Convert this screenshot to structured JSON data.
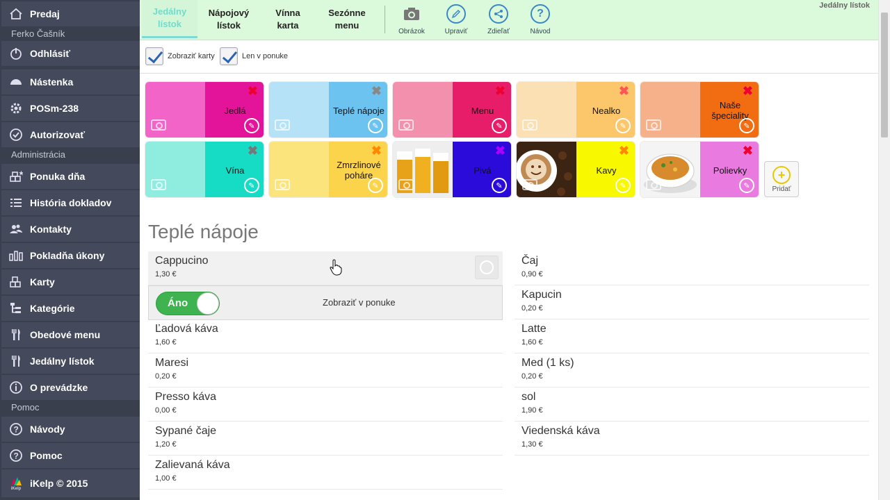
{
  "sidebar": {
    "items": [
      {
        "label": "Predaj",
        "icon": "home-icon"
      },
      {
        "label": "Odhlásiť",
        "icon": "power-icon"
      },
      {
        "label": "Nástenka",
        "icon": "dashboard-icon"
      },
      {
        "label": "POSm-238",
        "icon": "gear-icon"
      },
      {
        "label": "Autorizovať",
        "icon": "check-circle-icon"
      },
      {
        "label": "Ponuka dňa",
        "icon": "star-boxes-icon"
      },
      {
        "label": "História dokladov",
        "icon": "list-icon"
      },
      {
        "label": "Kontakty",
        "icon": "users-icon"
      },
      {
        "label": "Pokladňa úkony",
        "icon": "bars-icon"
      },
      {
        "label": "Karty",
        "icon": "boxes-icon"
      },
      {
        "label": "Kategórie",
        "icon": "tree-icon"
      },
      {
        "label": "Obedové menu",
        "icon": "cutlery-icon"
      },
      {
        "label": "Jedálny lístok",
        "icon": "cutlery-icon"
      },
      {
        "label": "O prevádzke",
        "icon": "info-icon"
      },
      {
        "label": "Návody",
        "icon": "question-icon"
      },
      {
        "label": "Pomoc",
        "icon": "question-icon"
      },
      {
        "label": "iKelp © 2015",
        "icon": "ikelp-logo"
      }
    ],
    "headers": {
      "user": "Ferko Čašník",
      "admin": "Administrácia",
      "help": "Pomoc"
    },
    "logo_small": "iKelp"
  },
  "topbar": {
    "tabs": [
      {
        "label": "Jedálny\nlístok",
        "active": true
      },
      {
        "label": "Nápojový\nlístok"
      },
      {
        "label": "Vínna\nkarta"
      },
      {
        "label": "Sezónne\nmenu"
      }
    ],
    "tools": [
      {
        "label": "Obrázok",
        "icon": "camera-icon"
      },
      {
        "label": "Upraviť",
        "icon": "pencil-icon"
      },
      {
        "label": "Zdieľať",
        "icon": "share-icon"
      },
      {
        "label": "Návod",
        "icon": "question-icon"
      }
    ],
    "title": "Jedálny lístok"
  },
  "checkboxes": {
    "show_cards": "Zobraziť karty",
    "only_menu": "Len v ponuke"
  },
  "tiles": [
    {
      "label": "Jedlá",
      "left": "#f264c8",
      "right": "#e4149a",
      "x": "#e03"
    },
    {
      "label": "Teplé nápoje",
      "left": "#b5e2f7",
      "right": "#6cc3f0",
      "x": "#888"
    },
    {
      "label": "Menu",
      "left": "#f290ad",
      "right": "#e81d69",
      "x": "#e03"
    },
    {
      "label": "Nealko",
      "left": "#fbe0b3",
      "right": "#fcc76b",
      "x": "#f55"
    },
    {
      "label": "Naše\nšpeciality",
      "left": "#f6b18a",
      "right": "#f26d12",
      "x": "#e03"
    },
    {
      "label": "Vína",
      "left": "#8fede0",
      "right": "#17dcc5",
      "x": "#777"
    },
    {
      "label": "Zmrzlinové\npoháre",
      "left": "#fbe47c",
      "right": "#fcd44b",
      "x": "#f80"
    },
    {
      "label": "Pivá",
      "left": "image-beer",
      "right": "#2a0bd9",
      "x": "#a0f"
    },
    {
      "label": "Kavy",
      "left": "image-coffee",
      "right": "#f8f800",
      "x": "#f80"
    },
    {
      "label": "Polievky",
      "left": "image-soup",
      "right": "#e97ae0",
      "x": "#e03"
    }
  ],
  "add_label": "Pridať",
  "section_title": "Teplé nápoje",
  "toggle": {
    "on_label": "Áno",
    "label": "Zobraziť v ponuke"
  },
  "items_left": [
    {
      "name": "Cappucino",
      "price": "1,30 €"
    },
    {
      "name": "Ľadová káva",
      "price": "1,60 €"
    },
    {
      "name": "Maresi",
      "price": "0,20 €"
    },
    {
      "name": "Presso káva",
      "price": "0,00 €"
    },
    {
      "name": "Sypané čaje",
      "price": "1,20 €"
    },
    {
      "name": "Zalievaná káva",
      "price": "1,00 €"
    }
  ],
  "items_right": [
    {
      "name": "Čaj",
      "price": "0,90 €"
    },
    {
      "name": "Kapucin",
      "price": "0,20 €"
    },
    {
      "name": "Latte",
      "price": "1,60 €"
    },
    {
      "name": "Med (1 ks)",
      "price": "0,20 €"
    },
    {
      "name": "sol",
      "price": "1,90 €"
    },
    {
      "name": "Viedenská káva",
      "price": "1,30 €"
    }
  ]
}
